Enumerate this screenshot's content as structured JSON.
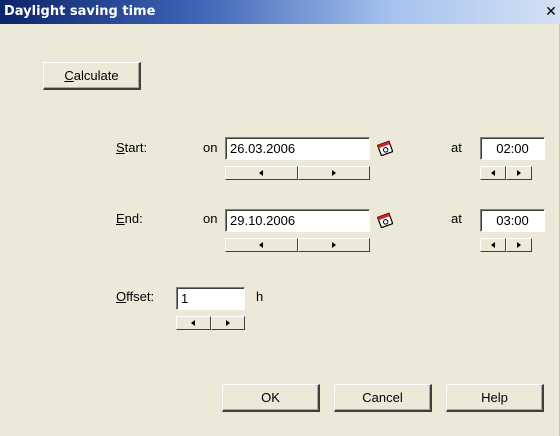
{
  "window": {
    "title": "Daylight saving time",
    "close_glyph": "✕"
  },
  "calculate_button": {
    "accel": "C",
    "rest": "alculate"
  },
  "start": {
    "label_accel": "S",
    "label_rest": "tart:",
    "on_label": "on",
    "date": "26.03.2006",
    "at_label": "at",
    "time": "02:00"
  },
  "end": {
    "label_accel": "E",
    "label_rest": "nd:",
    "on_label": "on",
    "date": "29.10.2006",
    "at_label": "at",
    "time": "03:00"
  },
  "offset": {
    "label_accel": "O",
    "label_rest": "ffset:",
    "value": "1",
    "unit": "h"
  },
  "buttons": {
    "ok": "OK",
    "cancel": "Cancel",
    "help": "Help"
  },
  "icons": {
    "calendar": "calendar-icon",
    "spin_left": "arrow-left-icon",
    "spin_right": "arrow-right-icon",
    "close": "close-icon"
  }
}
